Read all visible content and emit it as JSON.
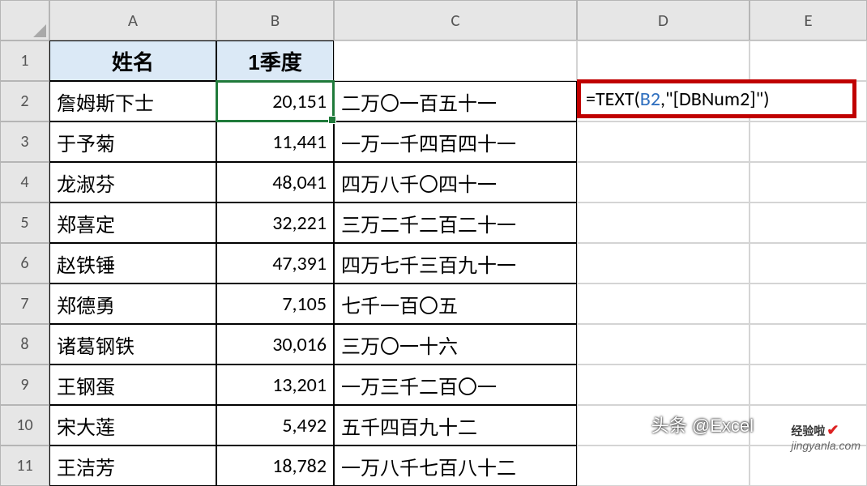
{
  "columns": {
    "A": "A",
    "B": "B",
    "C": "C",
    "D": "D",
    "E": "E"
  },
  "row_labels": [
    "1",
    "2",
    "3",
    "4",
    "5",
    "6",
    "7",
    "8",
    "9",
    "10",
    "11"
  ],
  "headers": {
    "A1": "姓名",
    "B1": "1季度"
  },
  "rows": [
    {
      "name": "詹姆斯下士",
      "value": "20,151",
      "text": "二万〇一百五十一"
    },
    {
      "name": "于予菊",
      "value": "11,441",
      "text": "一万一千四百四十一"
    },
    {
      "name": "龙淑芬",
      "value": "48,041",
      "text": "四万八千〇四十一"
    },
    {
      "name": "郑喜定",
      "value": "32,221",
      "text": "三万二千二百二十一"
    },
    {
      "name": "赵铁锤",
      "value": "47,391",
      "text": "四万七千三百九十一"
    },
    {
      "name": "郑德勇",
      "value": "7,105",
      "text": "七千一百〇五"
    },
    {
      "name": "诸葛钢铁",
      "value": "30,016",
      "text": "三万〇一十六"
    },
    {
      "name": "王钢蛋",
      "value": "13,201",
      "text": "一万三千二百〇一"
    },
    {
      "name": "宋大莲",
      "value": "5,492",
      "text": "五千四百九十二"
    },
    {
      "name": "王洁芳",
      "value": "18,782",
      "text": "一万八千七百八十二"
    }
  ],
  "formula": {
    "eq": "=",
    "fn_open": "TEXT(",
    "ref": "B2",
    "comma": ",",
    "str": "\"[DBNum2]\"",
    "close": ")"
  },
  "watermark": {
    "main": "头条 @Excel",
    "site1": "经验啦",
    "site2": "jingyanla.com",
    "check": "✔"
  }
}
